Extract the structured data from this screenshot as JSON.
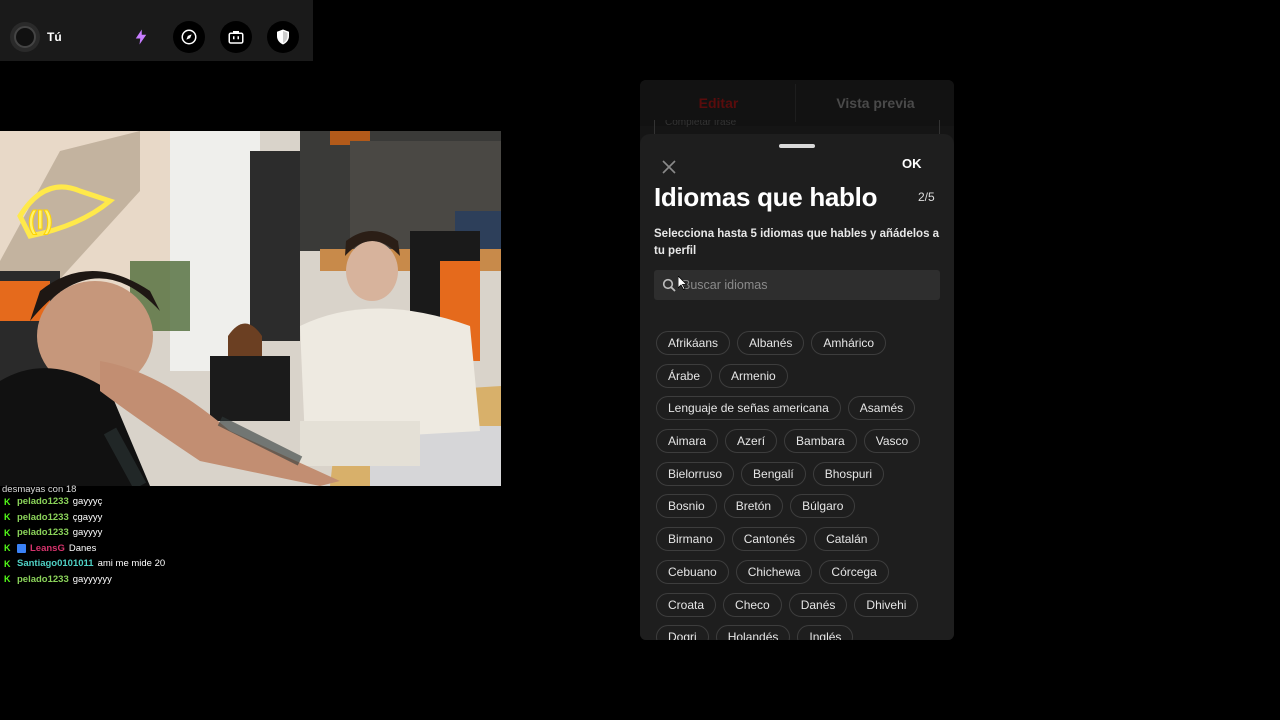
{
  "topbar": {
    "user_name": "Tú",
    "buttons": [
      {
        "icon": "lightning-icon",
        "color": "#c77dff"
      },
      {
        "icon": "compass-icon",
        "color": "#ffffff"
      },
      {
        "icon": "briefcase-icon",
        "color": "#ffffff"
      },
      {
        "icon": "shield-icon",
        "color": "#ffffff"
      }
    ]
  },
  "chat": {
    "cut_line": "desmayas con 18",
    "messages": [
      {
        "user": "pelado1233",
        "user_color": "#8bd35a",
        "text": "gayyyç"
      },
      {
        "user": "pelado1233",
        "user_color": "#8bd35a",
        "text": "çgayyy"
      },
      {
        "user": "pelado1233",
        "user_color": "#8bd35a",
        "text": "gayyyy"
      },
      {
        "user": "LeansG",
        "user_color": "#d6336c",
        "text": "Danes"
      },
      {
        "user": "Santiago0101011",
        "user_color": "#4fd1c5",
        "text": "ami me mide 20"
      },
      {
        "user": "pelado1233",
        "user_color": "#8bd35a",
        "text": "gayyyyyy"
      }
    ]
  },
  "phone": {
    "tabs": [
      "Editar",
      "Vista previa"
    ],
    "background_field": "Completar frase",
    "sheet": {
      "ok_label": "OK",
      "title": "Idiomas que hablo",
      "counter": "2/5",
      "subtitle": "Selecciona hasta 5 idiomas que hables y añádelos a tu perfil",
      "search_placeholder": "Buscar idiomas",
      "language_rows": [
        [
          "Afrikáans",
          "Albanés",
          "Amhárico"
        ],
        [
          "Árabe",
          "Armenio"
        ],
        [
          "Lenguaje de señas americana",
          "Asamés"
        ],
        [
          "Aimara",
          "Azerí",
          "Bambara",
          "Vasco"
        ],
        [
          "Bielorruso",
          "Bengalí",
          "Bhospuri"
        ],
        [
          "Bosnio",
          "Bretón",
          "Búlgaro"
        ],
        [
          "Birmano",
          "Cantonés",
          "Catalán"
        ],
        [
          "Cebuano",
          "Chichewa",
          "Córcega"
        ],
        [
          "Croata",
          "Checo",
          "Danés",
          "Dhivehi"
        ],
        [
          "Dogri",
          "Holandés",
          "Inglés"
        ]
      ]
    }
  }
}
